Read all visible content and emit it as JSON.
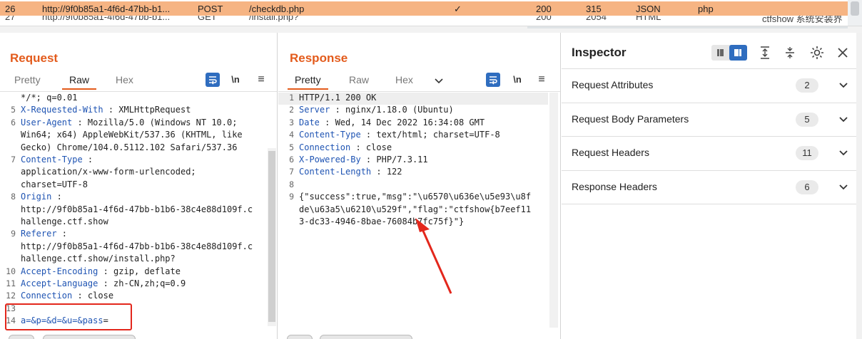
{
  "history": {
    "row1": {
      "num": "26",
      "url": "http://9f0b85a1-4f6d-47bb-b1...",
      "method": "POST",
      "path": "/checkdb.php",
      "check": "✓",
      "status": "200",
      "length": "315",
      "mime": "JSON",
      "ext": "php"
    },
    "row2": {
      "num": "27",
      "url": "http://9f0b85a1-4f6d-47bb-b1...",
      "method": "GET",
      "path": "/install.php?",
      "status": "200",
      "length": "2054",
      "mime": "HTML",
      "extra": "ctfshow 系统安装界"
    }
  },
  "request": {
    "title": "Request",
    "tabs": [
      "Pretty",
      "Raw",
      "Hex"
    ],
    "active_tab": "Raw",
    "lines": [
      {
        "n": "",
        "k": "",
        "v": "*/*; q=0.01"
      },
      {
        "n": "5",
        "k": "X-Requested-With",
        "v": " : XMLHttpRequest"
      },
      {
        "n": "6",
        "k": "User-Agent",
        "v": " : Mozilla/5.0  (Windows  NT 10.0;"
      },
      {
        "n": "",
        "k": "",
        "v": "Win64;  x64) AppleWebKit/537.36  (KHTML,  like"
      },
      {
        "n": "",
        "k": "",
        "v": "Gecko)  Chrome/104.0.5112.102   Safari/537.36"
      },
      {
        "n": "7",
        "k": "Content-Type",
        "v": " :"
      },
      {
        "n": "",
        "k": "",
        "v": "application/x-www-form-urlencoded;"
      },
      {
        "n": "",
        "k": "",
        "v": "charset=UTF-8"
      },
      {
        "n": "8",
        "k": "Origin",
        "v": " :"
      },
      {
        "n": "",
        "k": "",
        "v": "http://9f0b85a1-4f6d-47bb-b1b6-38c4e88d109f.c"
      },
      {
        "n": "",
        "k": "",
        "v": "hallenge.ctf.show"
      },
      {
        "n": "9",
        "k": "Referer",
        "v": " :"
      },
      {
        "n": "",
        "k": "",
        "v": "http://9f0b85a1-4f6d-47bb-b1b6-38c4e88d109f.c"
      },
      {
        "n": "",
        "k": "",
        "v": "hallenge.ctf.show/install.php?"
      },
      {
        "n": "10",
        "k": "Accept-Encoding",
        "v": " : gzip,  deflate"
      },
      {
        "n": "11",
        "k": "Accept-Language",
        "v": " : zh-CN,zh;q=0.9"
      },
      {
        "n": "12",
        "k": "Connection",
        "v": " : close"
      },
      {
        "n": "13",
        "k": "",
        "v": ""
      },
      {
        "n": "14",
        "k": "a=&p=&d=&u=&pass",
        "v": "="
      }
    ]
  },
  "response": {
    "title": "Response",
    "tabs": [
      "Pretty",
      "Raw",
      "Hex"
    ],
    "active_tab": "Pretty",
    "lines": [
      {
        "n": "1",
        "k": "",
        "v": "HTTP/1.1  200  OK"
      },
      {
        "n": "2",
        "k": "Server",
        "v": " : nginx/1.18.0  (Ubuntu)"
      },
      {
        "n": "3",
        "k": "Date",
        "v": " : Wed,  14 Dec  2022  16:34:08  GMT"
      },
      {
        "n": "4",
        "k": "Content-Type",
        "v": " : text/html;  charset=UTF-8"
      },
      {
        "n": "5",
        "k": "Connection",
        "v": " : close"
      },
      {
        "n": "6",
        "k": "X-Powered-By",
        "v": " : PHP/7.3.11"
      },
      {
        "n": "7",
        "k": "Content-Length",
        "v": " : 122"
      },
      {
        "n": "8",
        "k": "",
        "v": ""
      },
      {
        "n": "9",
        "k": "",
        "v": "{\"success\":true,\"msg\":\"\\u6570\\u636e\\u5e93\\u8f"
      },
      {
        "n": "",
        "k": "",
        "v": "de\\u63a5\\u6210\\u529f\",\"flag\":\"ctfshow{b7eef11"
      },
      {
        "n": "",
        "k": "",
        "v": "3-dc33-4946-8bae-76084b7fc75f}\"}"
      }
    ]
  },
  "inspector": {
    "title": "Inspector",
    "sections": [
      {
        "label": "Request Attributes",
        "count": "2"
      },
      {
        "label": "Request Body Parameters",
        "count": "5"
      },
      {
        "label": "Request Headers",
        "count": "11"
      },
      {
        "label": "Response Headers",
        "count": "6"
      }
    ]
  },
  "icons": {
    "wrap": "text-wrap-icon",
    "newline": "\\n",
    "menu": "≡",
    "chevron": "chevron-down-icon"
  },
  "colors": {
    "accent": "#e35b1c",
    "highlight_row": "#f6b483",
    "header_key": "#1f54b3",
    "toggle_blue": "#2f6dbf",
    "annotation_red": "#e3271c"
  }
}
